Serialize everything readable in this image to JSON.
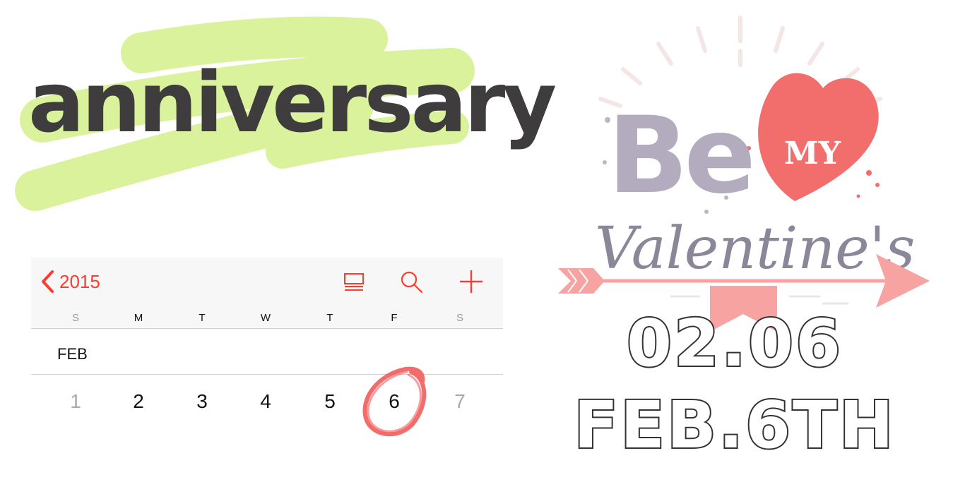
{
  "heading": {
    "word": "anniversary"
  },
  "calendar": {
    "year": "2015",
    "weekdays": [
      "S",
      "M",
      "T",
      "W",
      "T",
      "F",
      "S"
    ],
    "month": "FEB",
    "days": [
      "1",
      "2",
      "3",
      "4",
      "5",
      "6",
      "7"
    ],
    "circled_day": "6",
    "accent_color": "#ff3b30"
  },
  "valentine": {
    "line1": "Be",
    "heart_text": "MY",
    "line2": "Valentine's",
    "date_numeric": "02.06",
    "date_text": "FEB.6TH"
  },
  "colors": {
    "highlight": "#d4f08a",
    "heart": "#f26e6c",
    "be_letters": "#b3acbe",
    "valentines_script": "#8c8699",
    "arrow": "#f6a3a1",
    "circle": "#f25c5c"
  }
}
